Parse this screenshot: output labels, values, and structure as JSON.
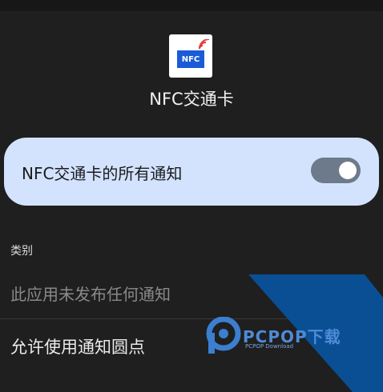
{
  "app": {
    "name": "NFC交通卡",
    "icon_text": "NFC"
  },
  "master_toggle": {
    "label": "NFC交通卡的所有通知",
    "state": "on"
  },
  "categories": {
    "header": "类别",
    "empty_message": "此应用未发布任何通知"
  },
  "notification_dot": {
    "label": "允许使用通知圆点"
  },
  "watermark": {
    "brand": "PCPOP下载",
    "sub": "PCPOP Download"
  },
  "colors": {
    "background": "#1f1f1f",
    "card": "#d3e3fd",
    "toggle_track": "#6d7a8c",
    "watermark_blue": "#0a4f94"
  }
}
